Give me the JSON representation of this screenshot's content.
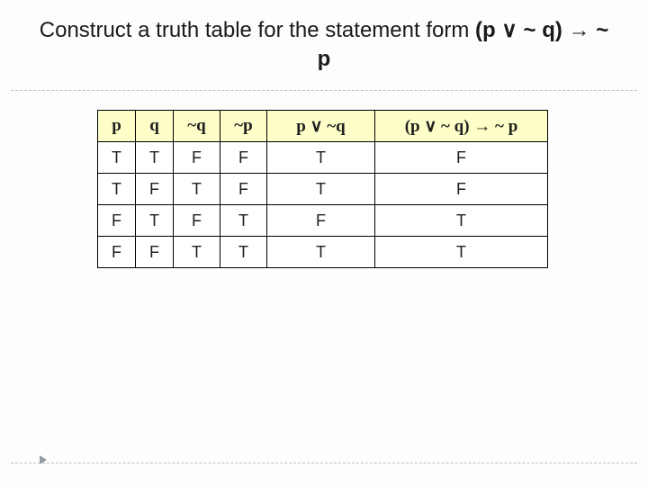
{
  "title": {
    "prefix": "Construct a truth table for the statement form ",
    "formula": "(p ∨ ~ q) → ~ p"
  },
  "table": {
    "headers": [
      "p",
      "q",
      "~q",
      "~p",
      "p ∨ ~q",
      "(p ∨ ~ q) → ~ p"
    ],
    "rows": [
      [
        "T",
        "T",
        "F",
        "F",
        "T",
        "F"
      ],
      [
        "T",
        "F",
        "T",
        "F",
        "T",
        "F"
      ],
      [
        "F",
        "T",
        "F",
        "T",
        "F",
        "T"
      ],
      [
        "F",
        "F",
        "T",
        "T",
        "T",
        "T"
      ]
    ]
  }
}
